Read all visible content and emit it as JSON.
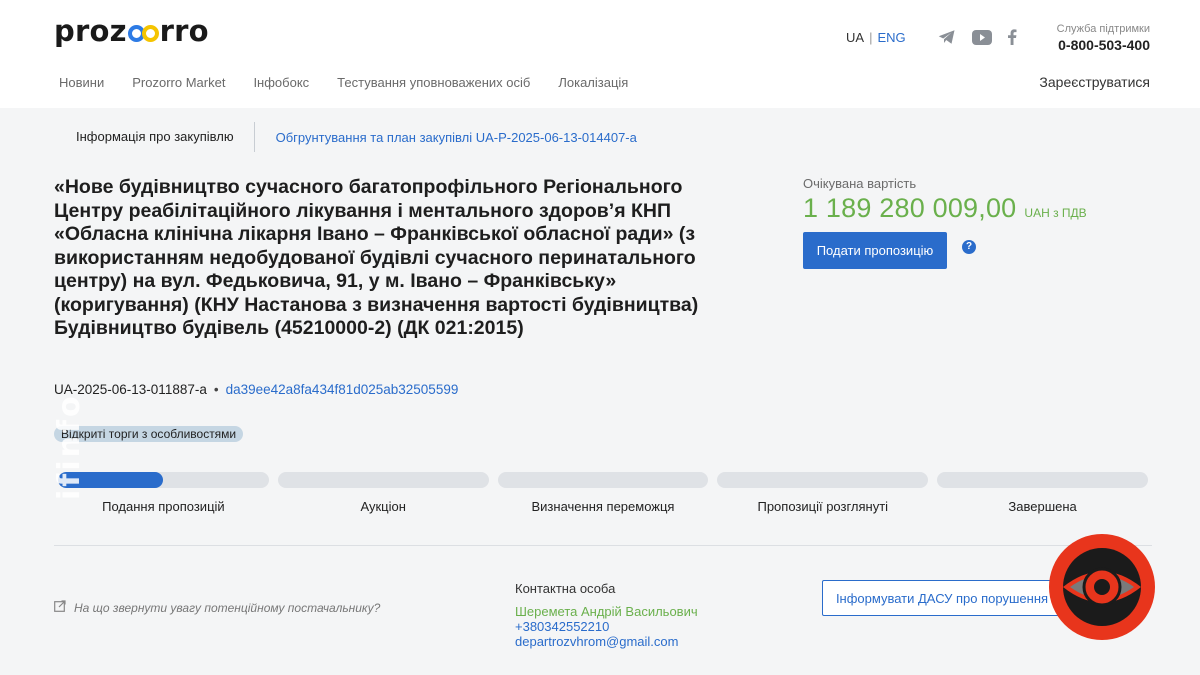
{
  "header": {
    "logo": "prozorro",
    "lang": {
      "ua": "UA",
      "sep": "|",
      "eng": "ENG"
    },
    "social": [
      "telegram-icon",
      "youtube-icon",
      "facebook-icon"
    ],
    "support": {
      "label": "Служба підтримки",
      "phone": "0-800-503-400"
    },
    "nav": [
      "Новини",
      "Prozorro Market",
      "Інфобокс",
      "Тестування уповноважених осіб",
      "Локалізація"
    ],
    "register": "Зареєструватися"
  },
  "tabs": {
    "info": "Інформація про закупівлю",
    "plan": "Обгрунтування та план закупівлі UA-P-2025-06-13-014407-a"
  },
  "tender": {
    "title": "«Нове будівництво сучасного багатопрофільного Регіонального Центру реабілітаційного лікування і ментального здоров’я КНП «Обласна клінічна лікарня Івано – Франківської обласної ради» (з використанням недобудованої будівлі сучасного перинатального центру) на вул. Федьковича, 91, у м. Івано – Франківську» (коригування) (КНУ Настанова з визначення вартості будівництва) Будівництво будівель (45210000-2) (ДК 021:2015)",
    "id": "UA-2025-06-13-011887-a",
    "separator": "•",
    "hash": "da39ee42a8fa434f81d025ab32505599",
    "procedure": "Відкриті торги з особливостями"
  },
  "value": {
    "label": "Очікувана вартість",
    "amount": "1 189 280 009,00",
    "unit": "UAH з ПДВ",
    "submit": "Подати пропозицію",
    "help": "?"
  },
  "steps": [
    {
      "label": "Подання пропозицій",
      "progress": 0.5
    },
    {
      "label": "Аукціон",
      "progress": 0
    },
    {
      "label": "Визначення переможця",
      "progress": 0
    },
    {
      "label": "Пропозиції розглянуті",
      "progress": 0
    },
    {
      "label": "Завершена",
      "progress": 0
    }
  ],
  "footer": {
    "hint": "На що звернути увагу потенційному постачальнику?",
    "contact_heading": "Контактна особа",
    "contact_name": "Шеремета Андрій Васильович",
    "contact_phone": "+380342552210",
    "contact_email": "departrozvhrom@gmail.com",
    "dasu_button": "Інформувати ДАСУ про порушення"
  },
  "colors": {
    "accent": "#2a6ccb",
    "green": "#6ab04c",
    "watermark_red": "#e8351c"
  }
}
